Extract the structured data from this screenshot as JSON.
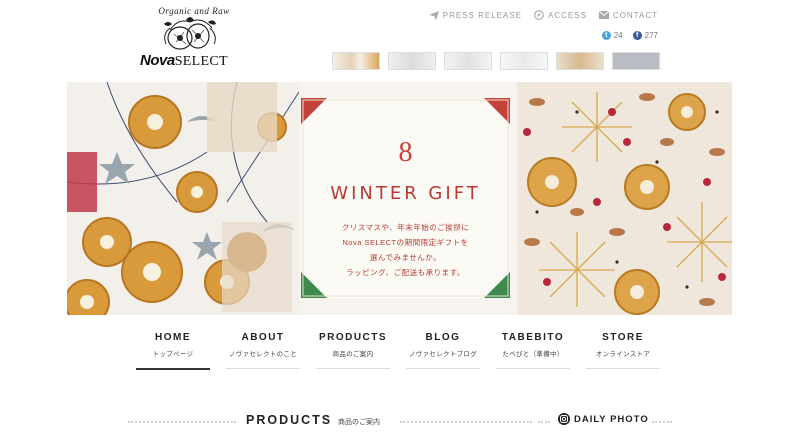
{
  "brand": {
    "tagline": "Organic and Raw",
    "name_bold": "Nova",
    "name_rest": "SELECT"
  },
  "topnav": [
    {
      "label": "PRESS RELEASE",
      "icon": "paper-plane-icon"
    },
    {
      "label": "ACCESS",
      "icon": "compass-icon"
    },
    {
      "label": "CONTACT",
      "icon": "mail-icon"
    }
  ],
  "social": {
    "twitter_count": "24",
    "facebook_count": "277",
    "twitter_color": "#4aa3df",
    "facebook_color": "#3b5998"
  },
  "hero": {
    "number": "8",
    "title": "WINTER GIFT",
    "lines": [
      "クリスマスや、年末年始のご挨拶に",
      "Nova SELECTの期間限定ギフトを",
      "選んでみませんか。",
      "ラッピング、ご配送も承ります。"
    ],
    "accent_red": "#c5423b",
    "accent_green": "#3e8a4c"
  },
  "mainnav": [
    {
      "en": "HOME",
      "ja": "トップページ"
    },
    {
      "en": "ABOUT",
      "ja": "ノヴァセレクトのこと"
    },
    {
      "en": "PRODUCTS",
      "ja": "商品のご案内"
    },
    {
      "en": "BLOG",
      "ja": "ノヴァセレクトブログ"
    },
    {
      "en": "TABEBITO",
      "ja": "たべびと（準備中）"
    },
    {
      "en": "STORE",
      "ja": "オンラインストア"
    }
  ],
  "sections": {
    "products_title": "PRODUCTS",
    "products_sub": "商品のご案内",
    "daily_photo": "DAILY PHOTO"
  }
}
